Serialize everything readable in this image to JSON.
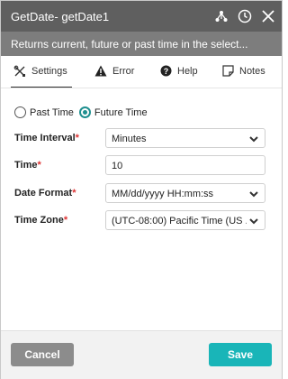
{
  "window": {
    "title": "GetDate-  getDate1",
    "description": "Returns current, future or past time in the select..."
  },
  "tabs": [
    {
      "label": "Settings",
      "icon": "settings-tools-icon",
      "active": true
    },
    {
      "label": "Error",
      "icon": "warning-icon"
    },
    {
      "label": "Help",
      "icon": "help-icon"
    },
    {
      "label": "Notes",
      "icon": "note-icon"
    }
  ],
  "time_mode": {
    "options": [
      "Past Time",
      "Future Time"
    ],
    "selected": "Future Time"
  },
  "form": {
    "time_interval": {
      "label": "Time Interval",
      "required_mark": "*",
      "value": "Minutes"
    },
    "time": {
      "label": "Time",
      "required_mark": "*",
      "value": "10"
    },
    "date_format": {
      "label": "Date Format",
      "required_mark": "*",
      "value": "MM/dd/yyyy HH:mm:ss"
    },
    "time_zone": {
      "label": "Time Zone",
      "required_mark": "*",
      "value": "(UTC-08:00) Pacific Time (US ..."
    }
  },
  "buttons": {
    "cancel": "Cancel",
    "save": "Save"
  },
  "colors": {
    "accent": "#19b5b8",
    "radio_selected": "#1e8f8f",
    "required": "#d33333",
    "titlebar": "#5f5f5f"
  }
}
